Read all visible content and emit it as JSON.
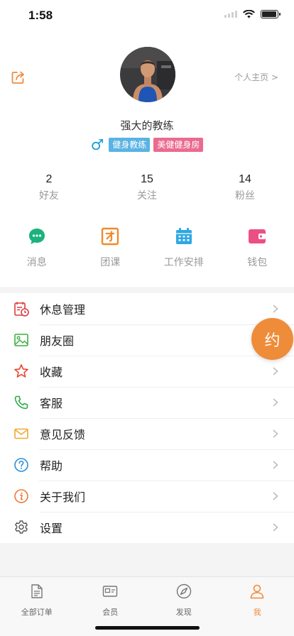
{
  "status": {
    "time": "1:58",
    "battery_level": 0.85
  },
  "profile": {
    "homepage_link": "个人主页 >",
    "name": "强大的教练",
    "gender_symbol": "♂",
    "tags": [
      "健身教练",
      "美健健身房"
    ]
  },
  "stats": [
    {
      "value": "2",
      "label": "好友"
    },
    {
      "value": "15",
      "label": "关注"
    },
    {
      "value": "14",
      "label": "粉丝"
    }
  ],
  "quick_actions": [
    {
      "label": "消息",
      "icon": "message-icon",
      "color": "#1bb37d"
    },
    {
      "label": "团课",
      "icon": "group-class-icon",
      "color": "#f08a2b"
    },
    {
      "label": "工作安排",
      "icon": "calendar-icon",
      "color": "#2fa8e1"
    },
    {
      "label": "钱包",
      "icon": "wallet-icon",
      "color": "#ec4f83"
    }
  ],
  "menu": [
    {
      "label": "休息管理",
      "icon": "rest-calendar-icon"
    },
    {
      "label": "朋友圈",
      "icon": "image-icon"
    },
    {
      "label": "收藏",
      "icon": "star-icon"
    },
    {
      "label": "客服",
      "icon": "phone-icon"
    },
    {
      "label": "意见反馈",
      "icon": "mail-icon"
    },
    {
      "label": "帮助",
      "icon": "help-icon"
    },
    {
      "label": "关于我们",
      "icon": "info-icon"
    },
    {
      "label": "设置",
      "icon": "gear-icon"
    }
  ],
  "fab_label": "约",
  "tabs": [
    {
      "label": "全部订单",
      "icon": "document-icon"
    },
    {
      "label": "会员",
      "icon": "member-card-icon"
    },
    {
      "label": "发现",
      "icon": "compass-icon"
    },
    {
      "label": "我",
      "icon": "person-icon",
      "active": true
    }
  ],
  "colors": {
    "accent": "#f08a3b",
    "tag_blue": "#5ab3e3",
    "tag_pink": "#ea6b90"
  }
}
